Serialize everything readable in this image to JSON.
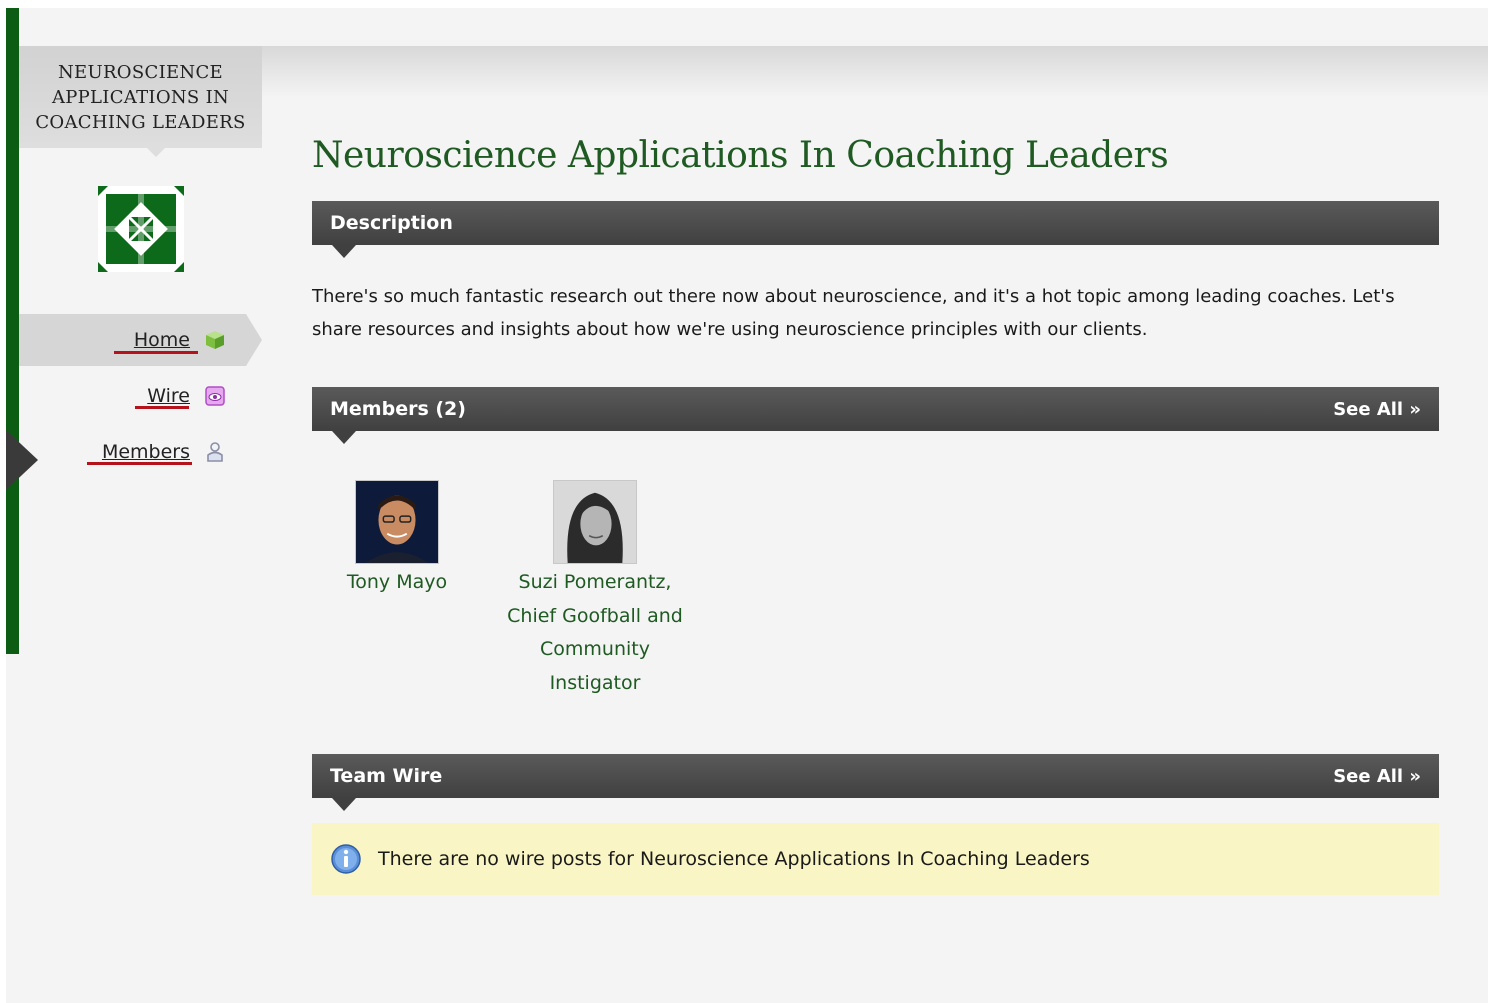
{
  "sidebar": {
    "title": "NEUROSCIENCE APPLICATIONS IN COACHING LEADERS",
    "logo_icon": "green-quilt-logo",
    "nav": [
      {
        "label": "Home",
        "icon": "home-cube-icon",
        "active": true
      },
      {
        "label": "Wire",
        "icon": "wire-eye-icon",
        "active": false
      },
      {
        "label": "Members",
        "icon": "members-person-icon",
        "active": false
      }
    ]
  },
  "main": {
    "title": "Neuroscience Applications In Coaching Leaders",
    "description": {
      "header": "Description",
      "text": "There's so much fantastic research out there now about neuroscience, and it's a hot topic among leading coaches. Let's share resources and insights about how we're using neuroscience principles with our clients."
    },
    "members": {
      "header": "Members (2)",
      "see_all": "See All »",
      "list": [
        {
          "name": "Tony Mayo"
        },
        {
          "name": "Suzi Pomerantz, Chief Goofball and Community Instigator"
        }
      ]
    },
    "team_wire": {
      "header": "Team Wire",
      "see_all": "See All »",
      "empty_message": "There are no wire posts for Neuroscience Applications In Coaching Leaders"
    }
  },
  "colors": {
    "sidebar_bar": "#0d5c14",
    "title": "#1e5a22",
    "header_bg": "#4a4a4a",
    "notice_bg": "#f9f5c4",
    "nav_underline": "#b5121b"
  }
}
